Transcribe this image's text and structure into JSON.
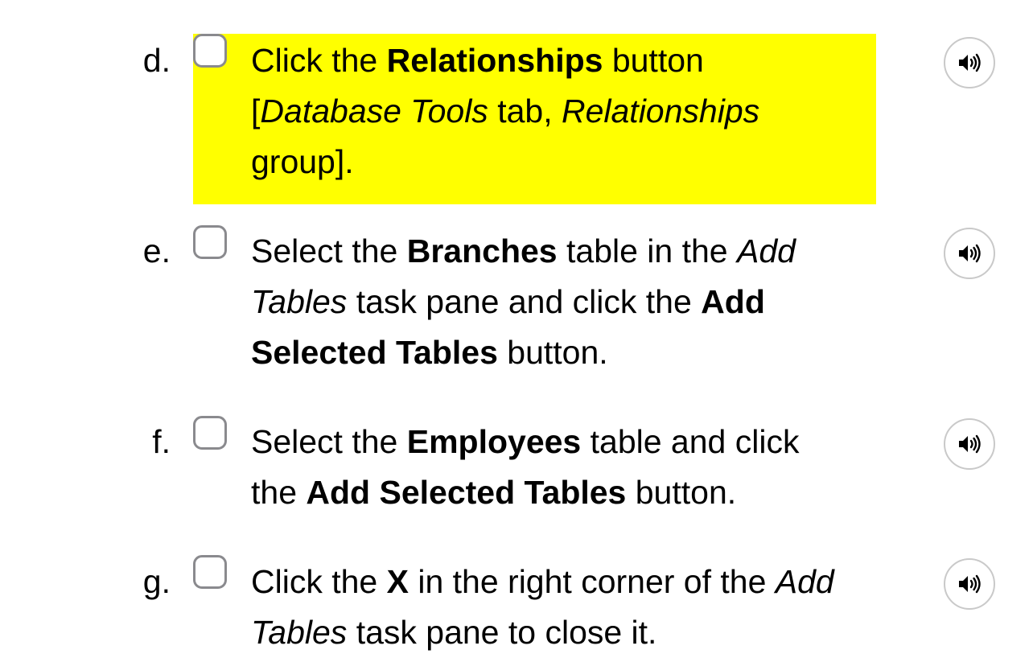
{
  "steps": [
    {
      "letter": "d.",
      "highlighted": true,
      "highlight_color": "#ffff00",
      "parts": [
        {
          "t": "Click the "
        },
        {
          "t": "Relationships",
          "b": true
        },
        {
          "t": " button"
        },
        {
          "br": true
        },
        {
          "t": "["
        },
        {
          "t": "Database Tools",
          "i": true
        },
        {
          "t": " tab, "
        },
        {
          "t": "Relationships",
          "i": true
        },
        {
          "br": true
        },
        {
          "t": "group]."
        }
      ],
      "audio_icon": "speaker-icon"
    },
    {
      "letter": "e.",
      "highlighted": false,
      "parts": [
        {
          "t": "Select the "
        },
        {
          "t": "Branches",
          "b": true
        },
        {
          "t": " table in the "
        },
        {
          "t": "Add",
          "i": true
        },
        {
          "br": true
        },
        {
          "t": "Tables",
          "i": true
        },
        {
          "t": " task pane and click the "
        },
        {
          "t": "Add",
          "b": true
        },
        {
          "br": true
        },
        {
          "t": "Selected Tables",
          "b": true
        },
        {
          "t": " button."
        }
      ],
      "audio_icon": "speaker-icon"
    },
    {
      "letter": "f.",
      "highlighted": false,
      "parts": [
        {
          "t": "Select the "
        },
        {
          "t": "Employees",
          "b": true
        },
        {
          "t": " table and click"
        },
        {
          "br": true
        },
        {
          "t": "the "
        },
        {
          "t": "Add Selected Tables",
          "b": true
        },
        {
          "t": " button."
        }
      ],
      "audio_icon": "speaker-icon"
    },
    {
      "letter": "g.",
      "highlighted": false,
      "parts": [
        {
          "t": "Click the "
        },
        {
          "t": "X",
          "b": true
        },
        {
          "t": " in the right corner of the "
        },
        {
          "t": "Add",
          "i": true
        },
        {
          "br": true
        },
        {
          "t": "Tables",
          "i": true
        },
        {
          "t": " task pane to close it."
        }
      ],
      "audio_icon": "speaker-icon"
    }
  ]
}
